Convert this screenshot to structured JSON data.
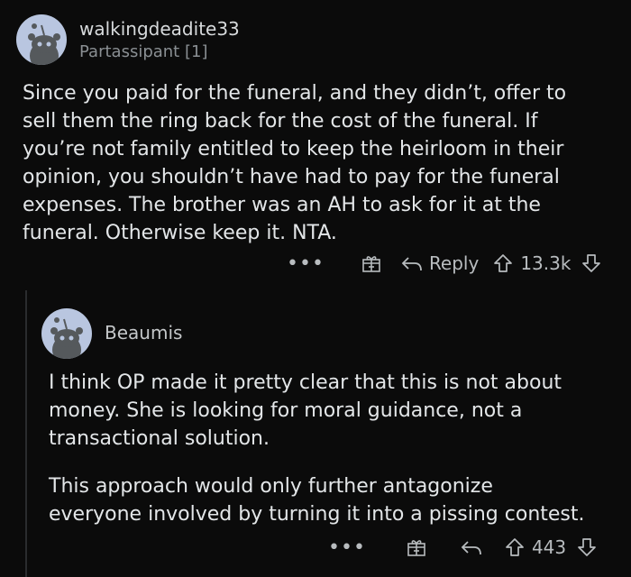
{
  "comment1": {
    "username": "walkingdeadite33",
    "flair": "Partassipant [1]",
    "lines": [
      "Since you paid for the funeral, and they didn’t, offer to",
      "sell them the ring back for the cost of the funeral. If",
      "you’re not family entitled to keep the heirloom in their",
      "opinion, you shouldn’t have had to pay for the funeral",
      "expenses. The brother was an AH to ask for it at the",
      "funeral.  Otherwise keep it. NTA."
    ],
    "actions": {
      "more": "•••",
      "reply_label": "Reply",
      "score": "13.3k"
    }
  },
  "comment2": {
    "username": "Beaumis",
    "paragraph1": [
      "I think OP made it pretty clear that this is not about",
      "money. She is looking for moral guidance, not a",
      "transactional solution."
    ],
    "paragraph2": [
      "This approach would only further antagonize",
      "everyone involved by turning it into a pissing contest."
    ],
    "actions": {
      "more": "•••",
      "score": "443"
    }
  },
  "icons": [
    "avatar-snoo",
    "gift-icon",
    "reply-arrow-icon",
    "upvote-icon",
    "downvote-icon",
    "more-icon"
  ],
  "colors": {
    "background": "#0b0b0b",
    "text": "#d7dadc",
    "muted": "#8a8f93",
    "avatar": "#b9c6e0"
  }
}
